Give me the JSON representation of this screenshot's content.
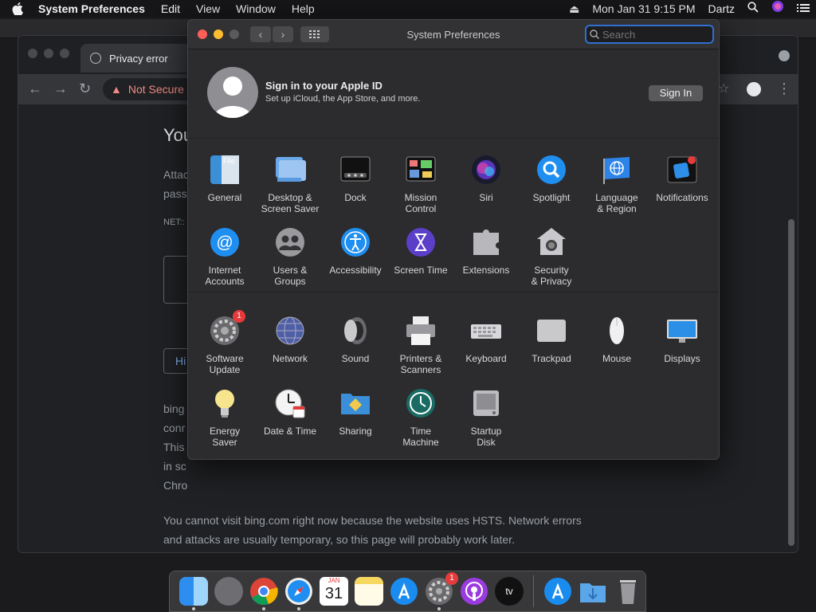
{
  "menubar": {
    "app": "System Preferences",
    "items": [
      "Edit",
      "View",
      "Window",
      "Help"
    ],
    "clock": "Mon Jan 31  9:15 PM",
    "user": "Dartz"
  },
  "chrome": {
    "tab_title": "Privacy error",
    "omnibox_label": "Not Secure",
    "heading": "You",
    "lines": {
      "l1": "Attac",
      "l2": "pass",
      "l3": "NET::",
      "btn": "Hi",
      "p1": "bing",
      "p2": "conr",
      "p3": "This",
      "p4": "in sc",
      "p5": "Chro",
      "hsts1": "You cannot visit bing.com right now because the website uses HSTS. Network errors",
      "hsts2": "and attacks are usually temporary, so this page will probably work later."
    }
  },
  "sysprefs": {
    "title": "System Preferences",
    "search_placeholder": "Search",
    "apple_id": {
      "title": "Sign in to your Apple ID",
      "subtitle": "Set up iCloud, the App Store, and more.",
      "button": "Sign In"
    },
    "row1": [
      {
        "l1": "General",
        "l2": "",
        "icon": "general-icon"
      },
      {
        "l1": "Desktop &",
        "l2": "Screen Saver",
        "icon": "desktop-icon"
      },
      {
        "l1": "Dock",
        "l2": "",
        "icon": "dock-icon"
      },
      {
        "l1": "Mission",
        "l2": "Control",
        "icon": "mission-control-icon"
      },
      {
        "l1": "Siri",
        "l2": "",
        "icon": "siri-icon"
      },
      {
        "l1": "Spotlight",
        "l2": "",
        "icon": "spotlight-icon"
      },
      {
        "l1": "Language",
        "l2": "& Region",
        "icon": "language-icon"
      },
      {
        "l1": "Notifications",
        "l2": "",
        "icon": "notifications-icon"
      }
    ],
    "row2": [
      {
        "l1": "Internet",
        "l2": "Accounts",
        "icon": "internet-accounts-icon"
      },
      {
        "l1": "Users &",
        "l2": "Groups",
        "icon": "users-icon"
      },
      {
        "l1": "Accessibility",
        "l2": "",
        "icon": "accessibility-icon"
      },
      {
        "l1": "Screen Time",
        "l2": "",
        "icon": "screen-time-icon"
      },
      {
        "l1": "Extensions",
        "l2": "",
        "icon": "extensions-icon"
      },
      {
        "l1": "Security",
        "l2": "& Privacy",
        "icon": "security-icon"
      }
    ],
    "row3": [
      {
        "l1": "Software",
        "l2": "Update",
        "icon": "software-update-icon",
        "badge": "1"
      },
      {
        "l1": "Network",
        "l2": "",
        "icon": "network-icon"
      },
      {
        "l1": "Sound",
        "l2": "",
        "icon": "sound-icon"
      },
      {
        "l1": "Printers &",
        "l2": "Scanners",
        "icon": "printer-icon"
      },
      {
        "l1": "Keyboard",
        "l2": "",
        "icon": "keyboard-icon"
      },
      {
        "l1": "Trackpad",
        "l2": "",
        "icon": "trackpad-icon"
      },
      {
        "l1": "Mouse",
        "l2": "",
        "icon": "mouse-icon"
      },
      {
        "l1": "Displays",
        "l2": "",
        "icon": "displays-icon"
      }
    ],
    "row4": [
      {
        "l1": "Energy",
        "l2": "Saver",
        "icon": "energy-saver-icon"
      },
      {
        "l1": "Date & Time",
        "l2": "",
        "icon": "date-time-icon"
      },
      {
        "l1": "Sharing",
        "l2": "",
        "icon": "sharing-icon"
      },
      {
        "l1": "Time",
        "l2": "Machine",
        "icon": "time-machine-icon"
      },
      {
        "l1": "Startup",
        "l2": "Disk",
        "icon": "startup-disk-icon"
      }
    ]
  },
  "dock": {
    "calendar_month": "JAN",
    "calendar_day": "31",
    "sysprefs_badge": "1",
    "tv_label": "tv"
  }
}
